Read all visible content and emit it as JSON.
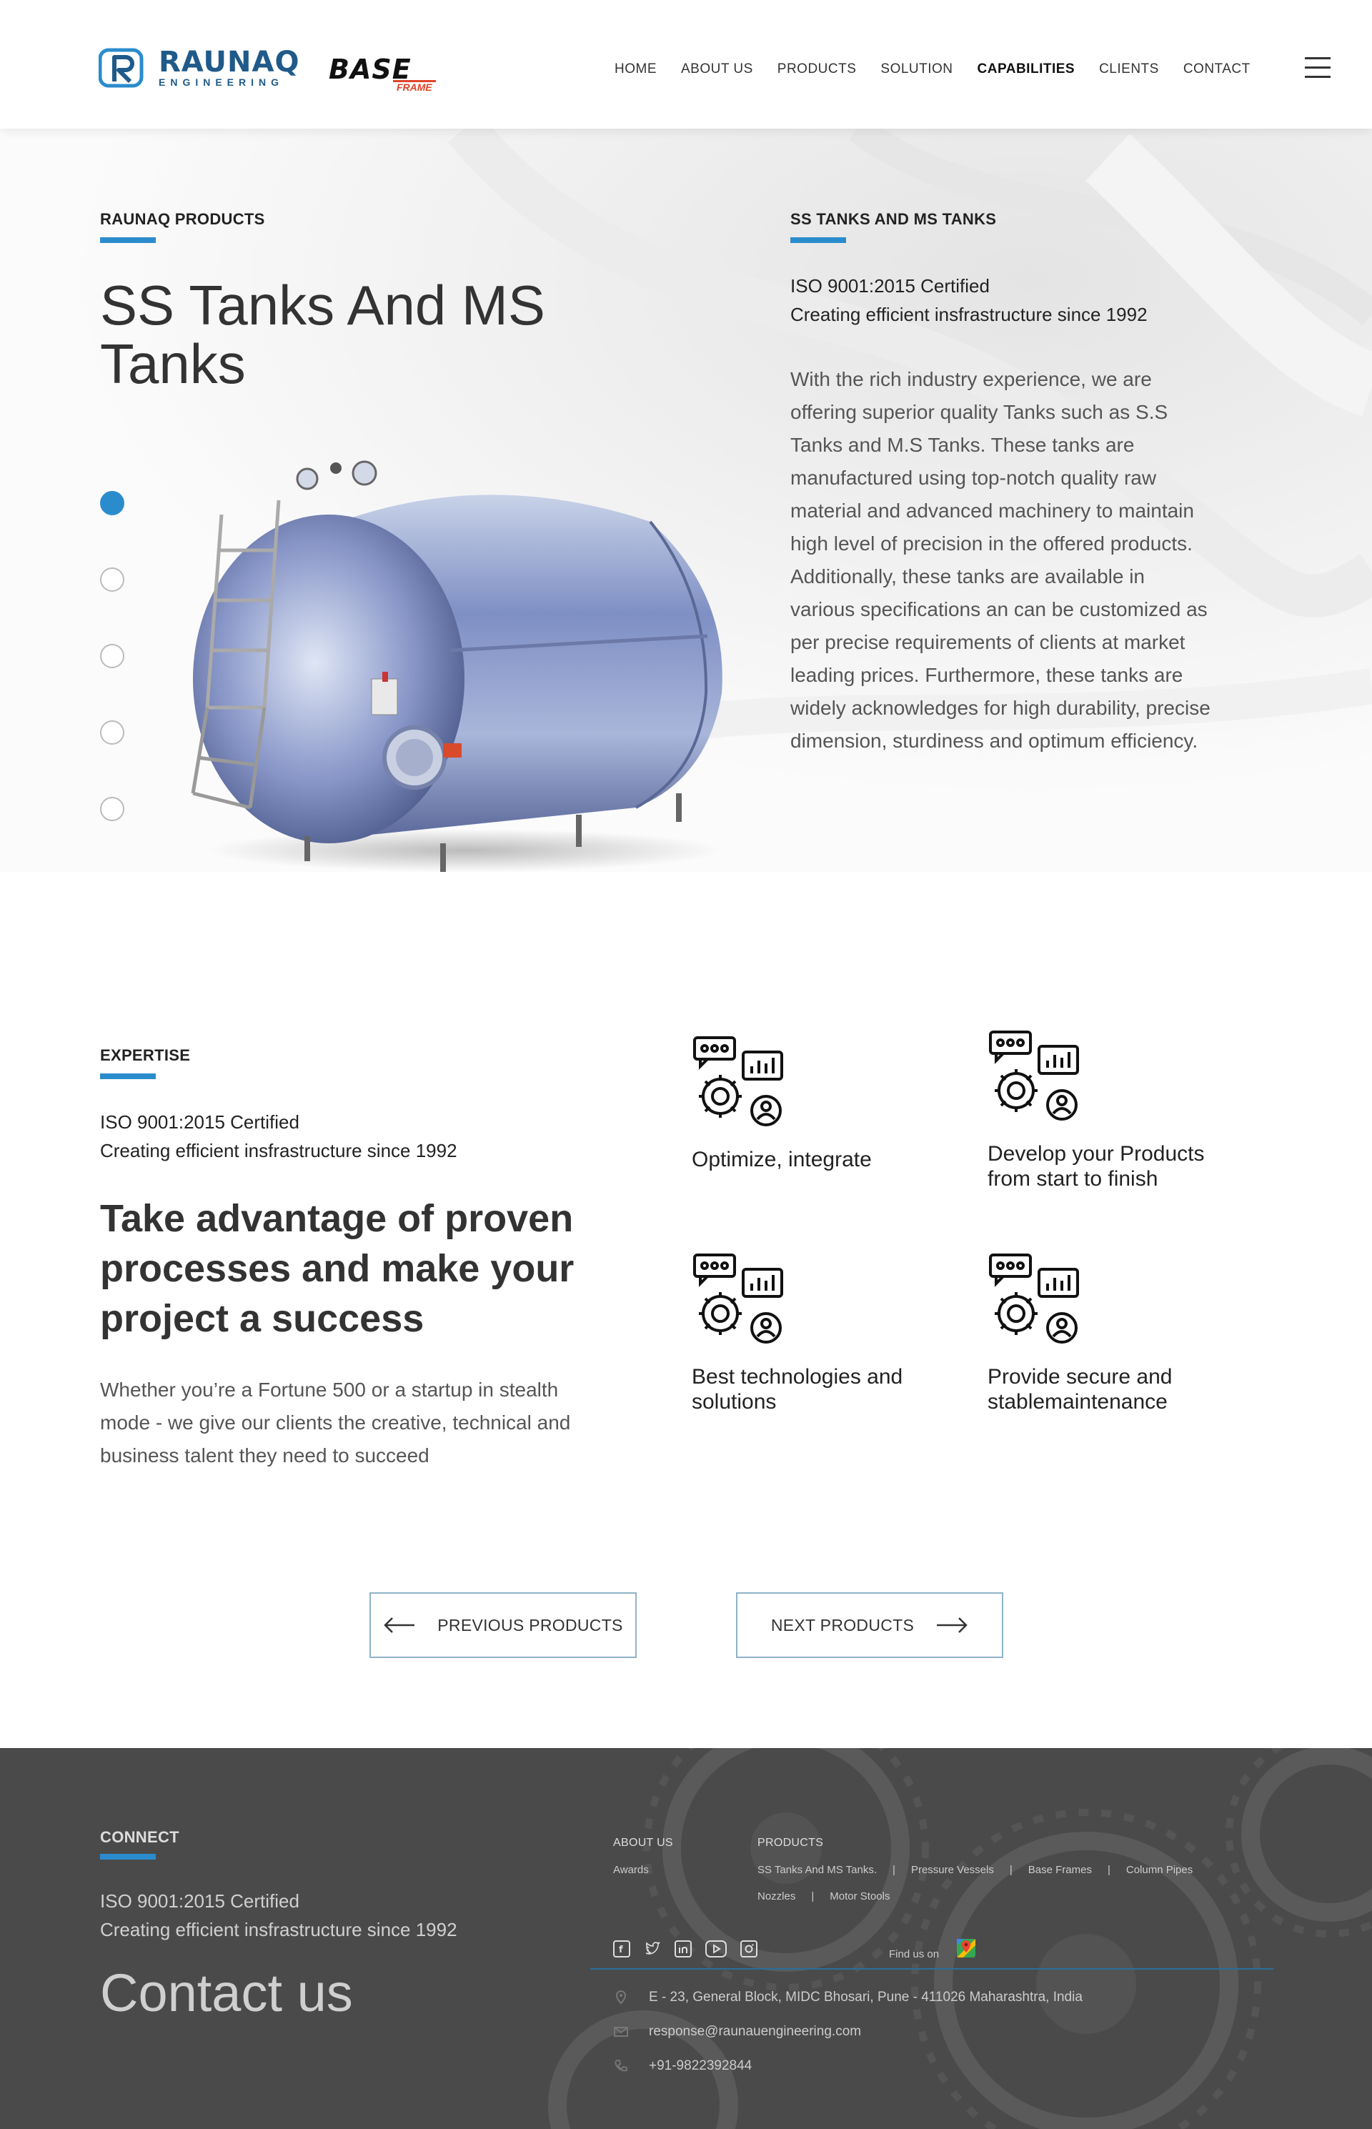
{
  "header": {
    "logo_name": "RAUNAQ",
    "logo_sub": "ENGINEERING",
    "base_main": "BASE",
    "base_sub": "FRAME",
    "nav": [
      "HOME",
      "ABOUT US",
      "PRODUCTS",
      "SOLUTION",
      "CAPABILITIES",
      "CLIENTS",
      "CONTACT"
    ],
    "active_nav": "CAPABILITIES"
  },
  "hero": {
    "eyebrow": "RAUNAQ PRODUCTS",
    "title": "SS Tanks And MS Tanks",
    "slider_count": 5,
    "slider_active": 1,
    "right_eyebrow": "SS TANKS AND MS TANKS",
    "cert_line1": "ISO 9001:2015 Certified",
    "cert_line2": "Creating efficient insfrastructure since 1992",
    "description": "With the rich industry experience, we are offering superior quality Tanks such as S.S Tanks and M.S Tanks. These tanks are manufactured using top-notch quality raw material and advanced machinery to maintain high level of precision in the offered products. Additionally, these tanks are available in various specifications an can be customized as per precise requirements of clients at market leading prices. Furthermore, these tanks are widely acknowledges for high durability, precise dimension, sturdiness and optimum efficiency."
  },
  "expertise": {
    "eyebrow": "EXPERTISE",
    "cert_line1": "ISO 9001:2015 Certified",
    "cert_line2": "Creating efficient insfrastructure since 1992",
    "heading": "Take advantage of proven processes and make your project a success",
    "description": "Whether you’re a Fortune 500 or a startup in stealth mode - we give our clients the creative, technical and business talent they need to succeed",
    "features": [
      {
        "label": "Optimize, integrate"
      },
      {
        "label": "Develop your Products from start to finish"
      },
      {
        "label": "Best technologies and solutions"
      },
      {
        "label": "Provide secure and stablemaintenance"
      }
    ]
  },
  "pager": {
    "prev": "PREVIOUS PRODUCTS",
    "next": "NEXT PRODUCTS"
  },
  "footer": {
    "eyebrow": "CONNECT",
    "cert_line1": "ISO 9001:2015 Certified",
    "cert_line2": "Creating efficient insfrastructure since 1992",
    "contact_title": "Contact us",
    "about_heading": "ABOUT US",
    "about_items": [
      "Awards"
    ],
    "products_heading": "PRODUCTS",
    "products_row1": [
      "SS Tanks And MS Tanks.",
      "Pressure Vessels",
      "Base Frames",
      "Column Pipes"
    ],
    "products_row2": [
      "Nozzles",
      "Motor Stools"
    ],
    "social": [
      "facebook-icon",
      "twitter-icon",
      "linkedin-icon",
      "youtube-icon",
      "instagram-icon"
    ],
    "find_us": "Find us on",
    "address": "E - 23, General Block, MIDC Bhosari, Pune - 411026 Maharashtra, India",
    "email": "response@raunauengineering.com",
    "phone": "+91-9822392844"
  },
  "colors": {
    "accent": "#2b8ccd",
    "brand": "#1f5a8a",
    "footer_bg": "#4a4a4a"
  }
}
